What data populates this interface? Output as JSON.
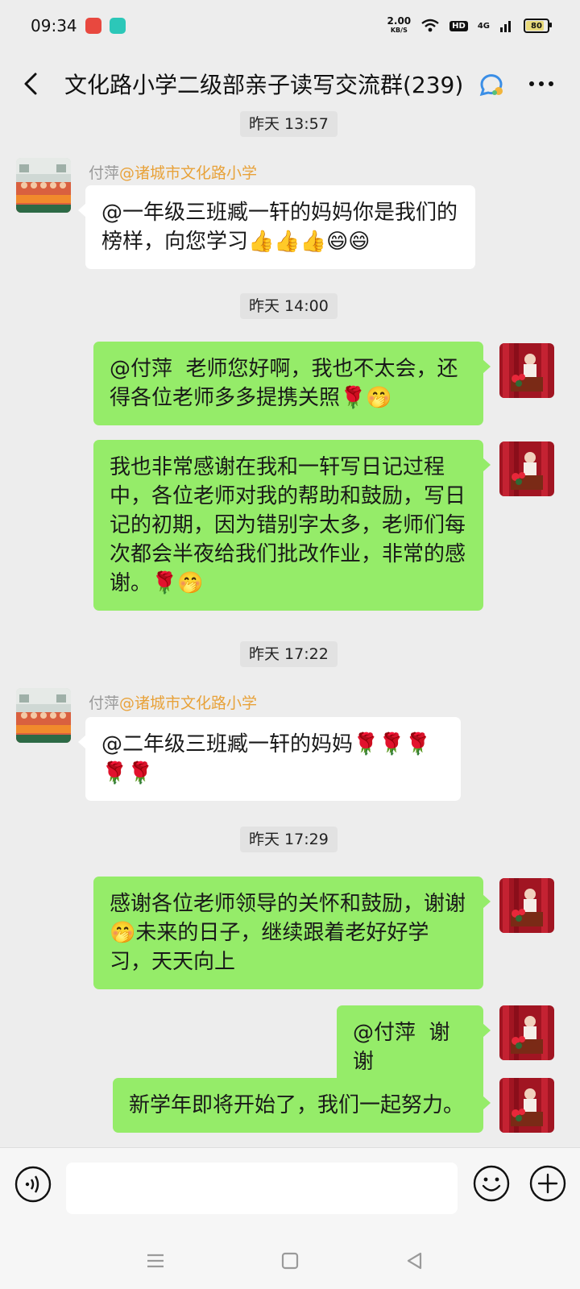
{
  "status_bar": {
    "time": "09:34",
    "net_speed_value": "2.00",
    "net_speed_unit": "KB/S",
    "hd": "HD",
    "network": "4G",
    "battery": "80"
  },
  "header": {
    "title": "文化路小学二级部亲子读写交流群(239)"
  },
  "messages": {
    "t1": "昨天 13:57",
    "m1_sender_name": "付萍",
    "m1_sender_mention": "@诸城市文化路小学",
    "m1_text": "@一年级三班臧一轩的妈妈你是我们的榜样，向您学习👍👍👍😄😄",
    "t2": "昨天 14:00",
    "m2_text": "@付萍  老师您好啊，我也不太会，还得各位老师多多提携关照🌹🤭",
    "m3_text": "我也非常感谢在我和一轩写日记过程中，各位老师对我的帮助和鼓励，写日记的初期，因为错别字太多，老师们每次都会半夜给我们批改作业，非常的感谢。🌹🤭",
    "t3": "昨天 17:22",
    "m4_sender_name": "付萍",
    "m4_sender_mention": "@诸城市文化路小学",
    "m4_text": "@二年级三班臧一轩的妈妈🌹🌹🌹🌹🌹",
    "t4": "昨天 17:29",
    "m5_text": "感谢各位老师领导的关怀和鼓励，谢谢🤭未来的日子，继续跟着老好好学习，天天向上",
    "m6_text": "@付萍  谢谢",
    "m7_text": "新学年即将开始了，我们一起努力。"
  },
  "colors": {
    "background": "#ededed",
    "outgoing_bubble": "#95ec69",
    "incoming_bubble": "#ffffff",
    "mention": "#e8a23a"
  },
  "icons": [
    "back-icon",
    "group-chat-icon",
    "more-icon",
    "voice-icon",
    "emoji-icon",
    "plus-icon",
    "menu-icon",
    "home-icon",
    "back-triangle-icon"
  ]
}
